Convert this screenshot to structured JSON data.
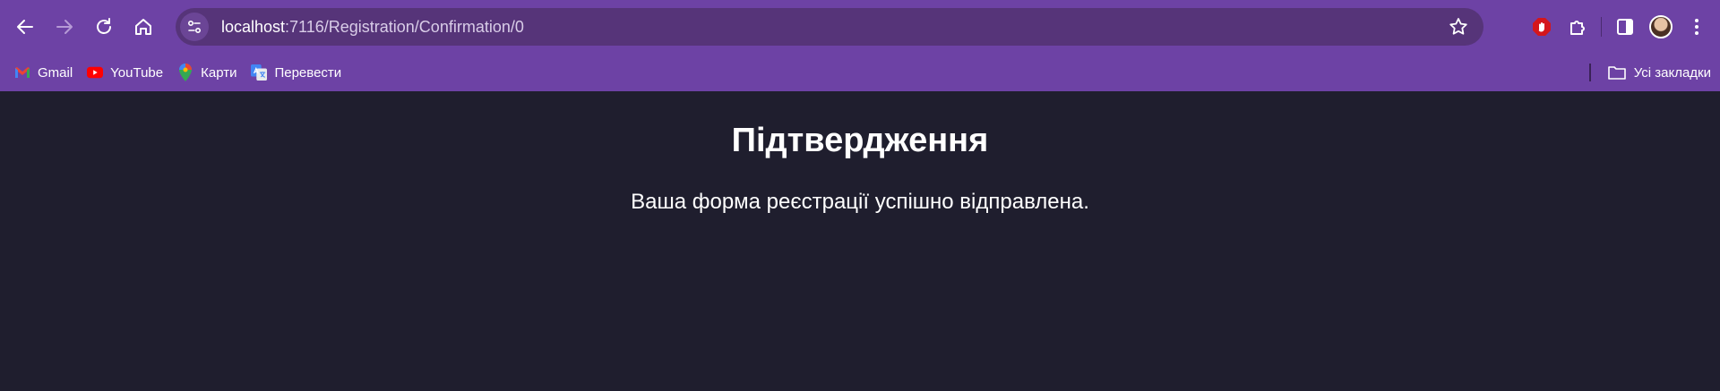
{
  "browser": {
    "url_host": "localhost",
    "url_path": ":7116/Registration/Confirmation/0"
  },
  "bookmarks": {
    "items": [
      {
        "label": "Gmail",
        "icon": "gmail-icon"
      },
      {
        "label": "YouTube",
        "icon": "youtube-icon"
      },
      {
        "label": "Карти",
        "icon": "maps-icon"
      },
      {
        "label": "Перевести",
        "icon": "translate-icon"
      }
    ],
    "all_bookmarks_label": "Усі закладки"
  },
  "page": {
    "heading": "Підтвердження",
    "message": "Ваша форма реєстрації успішно відправлена."
  },
  "colors": {
    "chrome": "#6d42a5",
    "omnibox": "#563479",
    "page_background": "#1f1e2e"
  }
}
